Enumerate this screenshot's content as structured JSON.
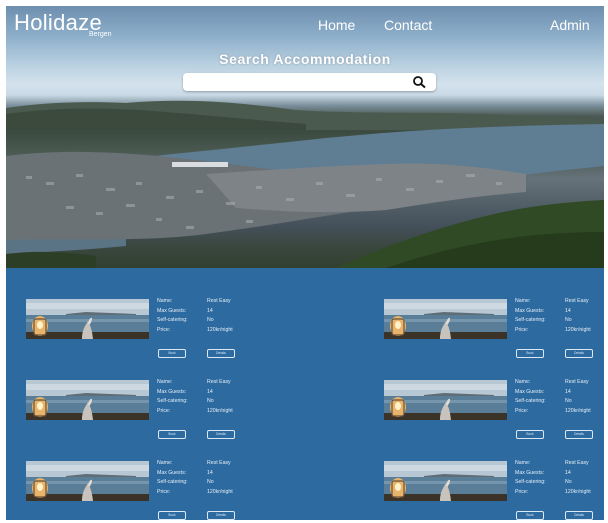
{
  "brand": {
    "name": "Holidaze",
    "location": "Bergen"
  },
  "nav": {
    "home": "Home",
    "contact": "Contact",
    "admin": "Admin"
  },
  "search": {
    "title": "Search Accommodation",
    "placeholder": "",
    "icon": "search-icon"
  },
  "listing_labels": {
    "name": "Name:",
    "max_guests": "Max Guests:",
    "self_catering": "Self-catering:",
    "price": "Price:",
    "button1": "Book",
    "button2": "Details"
  },
  "listings": [
    {
      "name": "Rest Easy",
      "max_guests": "14",
      "self_catering": "No",
      "price": "120kr/night"
    },
    {
      "name": "Rest Easy",
      "max_guests": "14",
      "self_catering": "No",
      "price": "120kr/night"
    },
    {
      "name": "Rest Easy",
      "max_guests": "14",
      "self_catering": "No",
      "price": "120kr/night"
    },
    {
      "name": "Rest Easy",
      "max_guests": "14",
      "self_catering": "No",
      "price": "120kr/night"
    },
    {
      "name": "Rest Easy",
      "max_guests": "14",
      "self_catering": "No",
      "price": "120kr/night"
    },
    {
      "name": "Rest Easy",
      "max_guests": "14",
      "self_catering": "No",
      "price": "120kr/night"
    }
  ],
  "colors": {
    "listing_bg": "#2c6aa0",
    "text": "#ffffff"
  }
}
